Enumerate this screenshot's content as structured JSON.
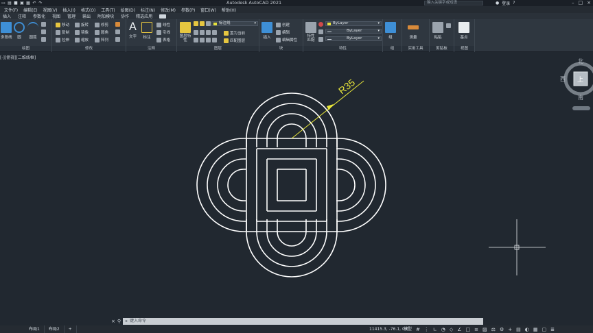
{
  "app": {
    "title": "Autodesk AutoCAD 2021",
    "search_placeholder": "键入关键字或短语",
    "user_label": "登录"
  },
  "menu": [
    "文件(F)",
    "编辑(E)",
    "视图(V)",
    "插入(I)",
    "格式(O)",
    "工具(T)",
    "绘图(D)",
    "标注(N)",
    "修改(M)",
    "参数(P)",
    "窗口(W)",
    "帮助(H)"
  ],
  "ribbon_tabs": [
    "插入",
    "注释",
    "参数化",
    "视图",
    "管理",
    "输出",
    "附加模块",
    "协作",
    "精选应用"
  ],
  "ribbon": {
    "draw": {
      "label": "绘图",
      "tools": [
        "多段线",
        "圆",
        "圆弧"
      ]
    },
    "modify": {
      "label": "修改",
      "tools": [
        "移动",
        "旋转",
        "修剪",
        "复制",
        "镜像",
        "圆角",
        "拉伸",
        "缩放",
        "阵列"
      ]
    },
    "annotation": {
      "label": "注释",
      "tools": [
        "文字",
        "标注",
        "线性",
        "引线",
        "表格"
      ]
    },
    "layers": {
      "label": "图层",
      "layer_props": "图层特性",
      "current_layer": "标注线",
      "tools": [
        "置为当前",
        "匹配图层"
      ]
    },
    "block": {
      "label": "块",
      "tools": [
        "插入",
        "创建",
        "编辑",
        "编辑属性"
      ]
    },
    "properties": {
      "label": "特性",
      "match": "特性匹配",
      "color": "ByLayer",
      "linetype": "ByLayer",
      "lineweight": "ByLayer"
    },
    "groups": {
      "label": "组",
      "tool": "组"
    },
    "utilities": {
      "label": "实用工具",
      "tool": "测量"
    },
    "clipboard": {
      "label": "剪贴板",
      "tool": "粘贴"
    },
    "view": {
      "label": "视图",
      "tool": "基点"
    }
  },
  "viewport": {
    "label": "[-][俯视][二维线框]"
  },
  "viewcube": {
    "north": "北",
    "south": "南",
    "west": "西",
    "face": "上"
  },
  "drawing": {
    "dimension_text": "R35",
    "line_color": "#ffffff",
    "dimension_color": "#e8e63a"
  },
  "command": {
    "placeholder": "键入命令"
  },
  "status": {
    "layout_tabs": [
      "布局1",
      "布局2"
    ],
    "add_tab": "+",
    "coords": "11415.3, -76.1, 0.0",
    "model": "模型"
  }
}
